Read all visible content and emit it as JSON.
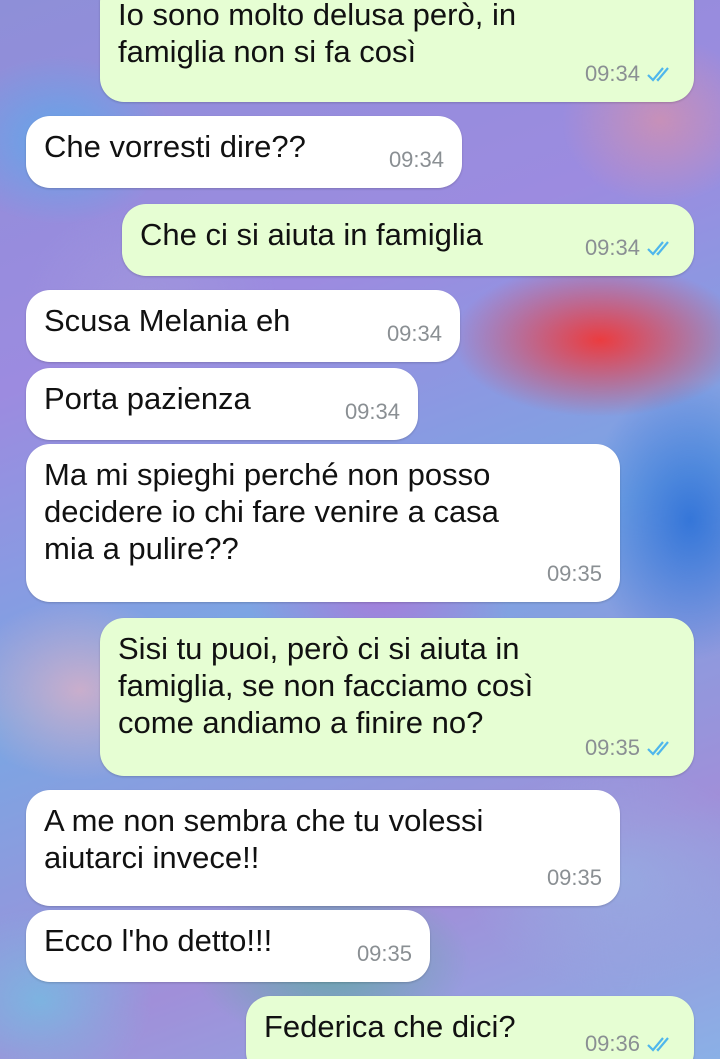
{
  "messages": [
    {
      "direction": "out",
      "text": "Io sono molto delusa però, in\nfamiglia non si fa così",
      "time": "09:34",
      "status": "read"
    },
    {
      "direction": "in",
      "text": "Che vorresti dire??",
      "time": "09:34"
    },
    {
      "direction": "out",
      "text": "Che ci si aiuta in famiglia",
      "time": "09:34",
      "status": "read"
    },
    {
      "direction": "in",
      "text": "Scusa Melania eh",
      "time": "09:34"
    },
    {
      "direction": "in",
      "text": "Porta pazienza",
      "time": "09:34"
    },
    {
      "direction": "in",
      "text": "Ma mi spieghi perché non posso\ndecidere io chi fare venire a casa\nmia a pulire??",
      "time": "09:35"
    },
    {
      "direction": "out",
      "text": "Sisi tu puoi, però ci si aiuta in\nfamiglia, se non facciamo così\ncome andiamo a finire no?",
      "time": "09:35",
      "status": "read"
    },
    {
      "direction": "in",
      "text": "A me non sembra che tu volessi\naiutarci invece!!",
      "time": "09:35"
    },
    {
      "direction": "in",
      "text": "Ecco l'ho detto!!!",
      "time": "09:35"
    },
    {
      "direction": "out",
      "text": "Federica che dici?",
      "time": "09:36",
      "status": "read"
    }
  ],
  "colors": {
    "incoming_bubble": "#ffffff",
    "outgoing_bubble": "#e6fed3",
    "read_ticks": "#4fb6ec",
    "timestamp": "#8a8f93"
  },
  "icons": {
    "read_receipt": "double-check-icon"
  }
}
